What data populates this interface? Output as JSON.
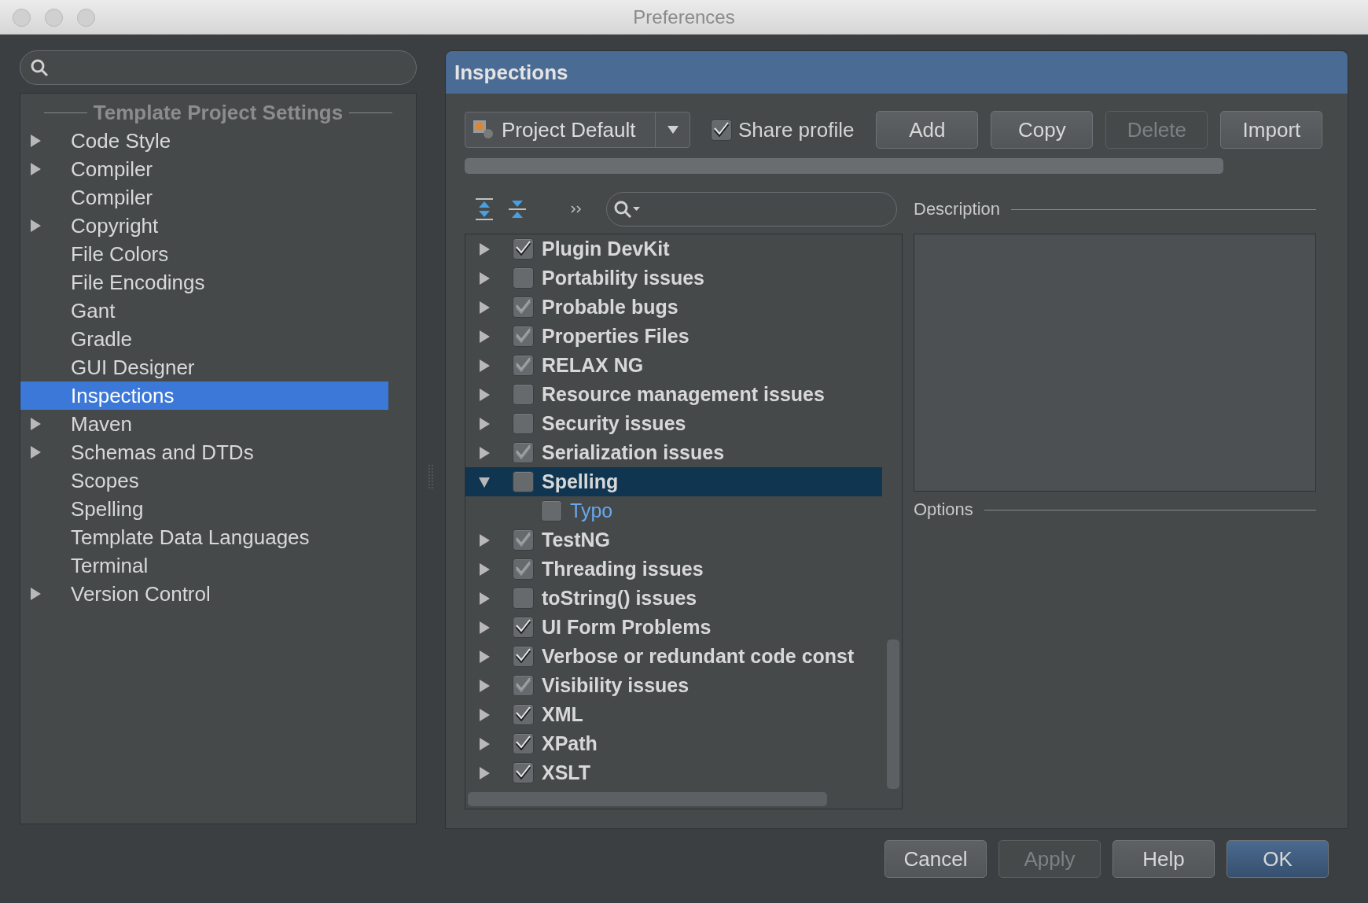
{
  "window": {
    "title": "Preferences"
  },
  "sidebar": {
    "heading": "Template Project Settings",
    "items": [
      {
        "label": "Code Style",
        "expandable": true,
        "selected": false
      },
      {
        "label": "Compiler",
        "expandable": true,
        "selected": false
      },
      {
        "label": "Compiler",
        "expandable": false,
        "selected": false
      },
      {
        "label": "Copyright",
        "expandable": true,
        "selected": false
      },
      {
        "label": "File Colors",
        "expandable": false,
        "selected": false
      },
      {
        "label": "File Encodings",
        "expandable": false,
        "selected": false
      },
      {
        "label": "Gant",
        "expandable": false,
        "selected": false
      },
      {
        "label": "Gradle",
        "expandable": false,
        "selected": false
      },
      {
        "label": "GUI Designer",
        "expandable": false,
        "selected": false
      },
      {
        "label": "Inspections",
        "expandable": false,
        "selected": true
      },
      {
        "label": "Maven",
        "expandable": true,
        "selected": false
      },
      {
        "label": "Schemas and DTDs",
        "expandable": true,
        "selected": false
      },
      {
        "label": "Scopes",
        "expandable": false,
        "selected": false
      },
      {
        "label": "Spelling",
        "expandable": false,
        "selected": false
      },
      {
        "label": "Template Data Languages",
        "expandable": false,
        "selected": false
      },
      {
        "label": "Terminal",
        "expandable": false,
        "selected": false
      },
      {
        "label": "Version Control",
        "expandable": true,
        "selected": false
      }
    ]
  },
  "panel": {
    "title": "Inspections"
  },
  "profile": {
    "value": "Project Default"
  },
  "share_profile": {
    "label": "Share profile",
    "checked": true
  },
  "profile_buttons": [
    {
      "label": "Add",
      "disabled": false
    },
    {
      "label": "Copy",
      "disabled": false
    },
    {
      "label": "Delete",
      "disabled": true
    },
    {
      "label": "Import",
      "disabled": false
    }
  ],
  "tree": {
    "rows": [
      {
        "label": "Plugin DevKit",
        "checked": true,
        "greyed": false,
        "expanded": false,
        "selected": false
      },
      {
        "label": "Portability issues",
        "checked": false,
        "expanded": false,
        "selected": false
      },
      {
        "label": "Probable bugs",
        "checked": true,
        "greyed": true,
        "expanded": false,
        "selected": false
      },
      {
        "label": "Properties Files",
        "checked": true,
        "greyed": true,
        "expanded": false,
        "selected": false
      },
      {
        "label": "RELAX NG",
        "checked": true,
        "greyed": true,
        "expanded": false,
        "selected": false
      },
      {
        "label": "Resource management issues",
        "checked": false,
        "expanded": false,
        "selected": false
      },
      {
        "label": "Security issues",
        "checked": false,
        "expanded": false,
        "selected": false
      },
      {
        "label": "Serialization issues",
        "checked": true,
        "greyed": true,
        "expanded": false,
        "selected": false
      },
      {
        "label": "Spelling",
        "checked": false,
        "expanded": true,
        "selected": true,
        "children": [
          {
            "label": "Typo",
            "checked": false
          }
        ]
      },
      {
        "label": "TestNG",
        "checked": true,
        "greyed": true,
        "expanded": false,
        "selected": false
      },
      {
        "label": "Threading issues",
        "checked": true,
        "greyed": true,
        "expanded": false,
        "selected": false
      },
      {
        "label": "toString() issues",
        "checked": false,
        "expanded": false,
        "selected": false
      },
      {
        "label": "UI Form Problems",
        "checked": true,
        "greyed": false,
        "expanded": false,
        "selected": false
      },
      {
        "label": "Verbose or redundant code const",
        "checked": true,
        "greyed": false,
        "expanded": false,
        "selected": false
      },
      {
        "label": "Visibility issues",
        "checked": true,
        "greyed": true,
        "expanded": false,
        "selected": false
      },
      {
        "label": "XML",
        "checked": true,
        "greyed": false,
        "expanded": false,
        "selected": false
      },
      {
        "label": "XPath",
        "checked": true,
        "greyed": false,
        "expanded": false,
        "selected": false
      },
      {
        "label": "XSLT",
        "checked": true,
        "greyed": false,
        "expanded": false,
        "selected": false
      }
    ]
  },
  "description": {
    "label": "Description"
  },
  "options": {
    "label": "Options"
  },
  "buttons": [
    {
      "label": "Cancel",
      "disabled": false,
      "default": false
    },
    {
      "label": "Apply",
      "disabled": true,
      "default": false
    },
    {
      "label": "Help",
      "disabled": false,
      "default": false
    },
    {
      "label": "OK",
      "disabled": false,
      "default": true
    }
  ]
}
